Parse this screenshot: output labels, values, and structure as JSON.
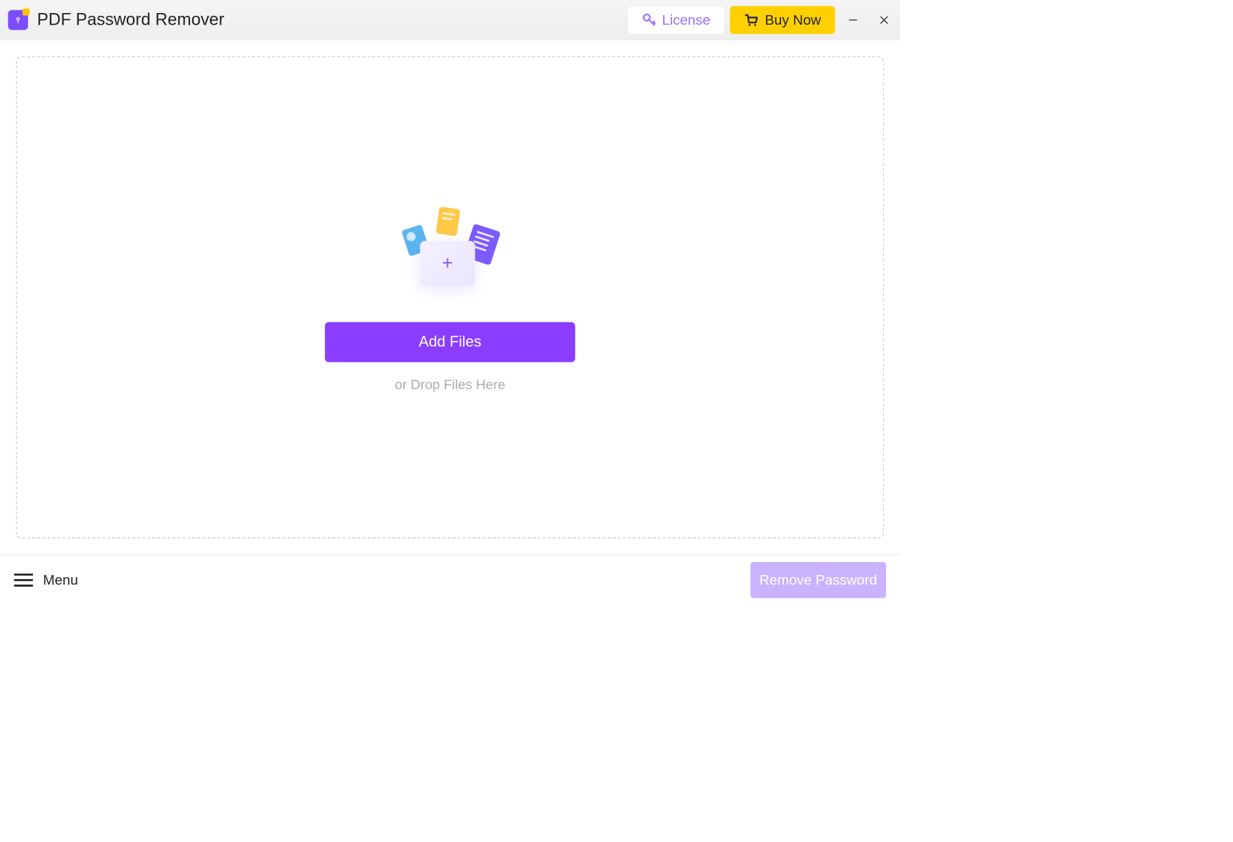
{
  "header": {
    "app_title": "PDF Password Remover",
    "license_label": "License",
    "buy_label": "Buy Now"
  },
  "main": {
    "add_files_label": "Add Files",
    "drop_text": "or Drop Files Here"
  },
  "footer": {
    "menu_label": "Menu",
    "remove_label": "Remove Password"
  },
  "colors": {
    "accent": "#8b3dff",
    "buy_bg": "#ffd000",
    "disabled": "#c9b3ff"
  }
}
